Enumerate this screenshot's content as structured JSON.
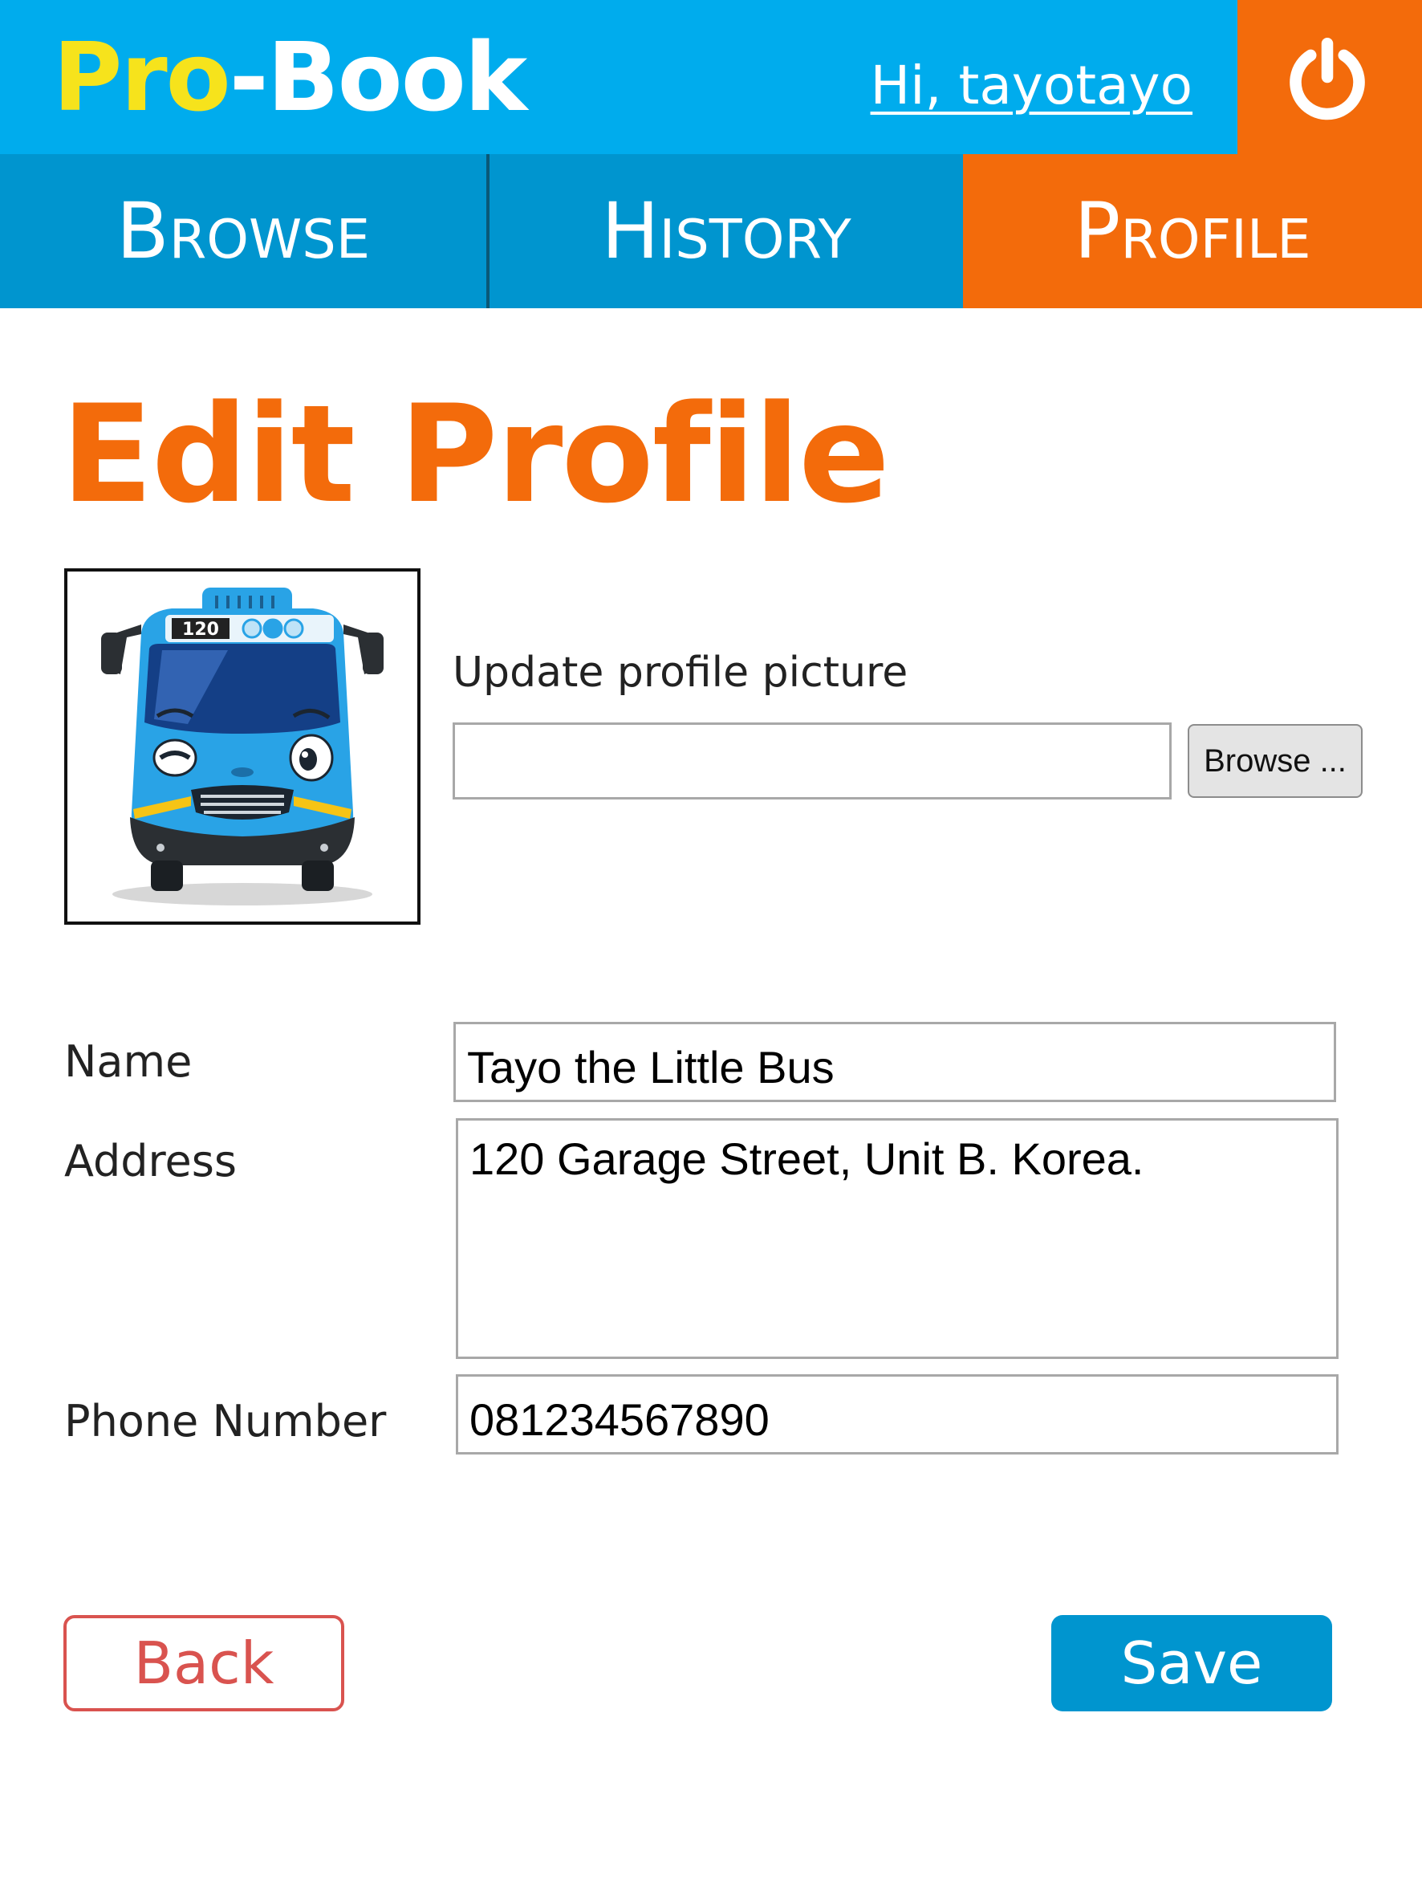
{
  "header": {
    "logo": {
      "part1": "Pro",
      "separator": "-",
      "part2": "Book"
    },
    "greeting": "Hi, tayotayo",
    "logout_icon": "power-icon"
  },
  "nav": {
    "tabs": [
      {
        "label": "Browse",
        "active": false
      },
      {
        "label": "History",
        "active": false
      },
      {
        "label": "Profile",
        "active": true
      }
    ]
  },
  "page": {
    "title": "Edit Profile"
  },
  "profile_picture": {
    "image": "tayo-bus-avatar",
    "bus_number": "120",
    "label": "Update profile picture",
    "file_path": "",
    "browse_label": "Browse ..."
  },
  "form": {
    "name": {
      "label": "Name",
      "value": "Tayo the Little Bus"
    },
    "address": {
      "label": "Address",
      "value": "120 Garage Street, Unit B. Korea."
    },
    "phone": {
      "label": "Phone Number",
      "value": "081234567890"
    }
  },
  "actions": {
    "back_label": "Back",
    "save_label": "Save"
  },
  "colors": {
    "header_blue": "#00aced",
    "nav_blue": "#0095cf",
    "accent_orange": "#f36b0b",
    "logo_yellow": "#f6e31c",
    "back_red": "#d9534f"
  }
}
